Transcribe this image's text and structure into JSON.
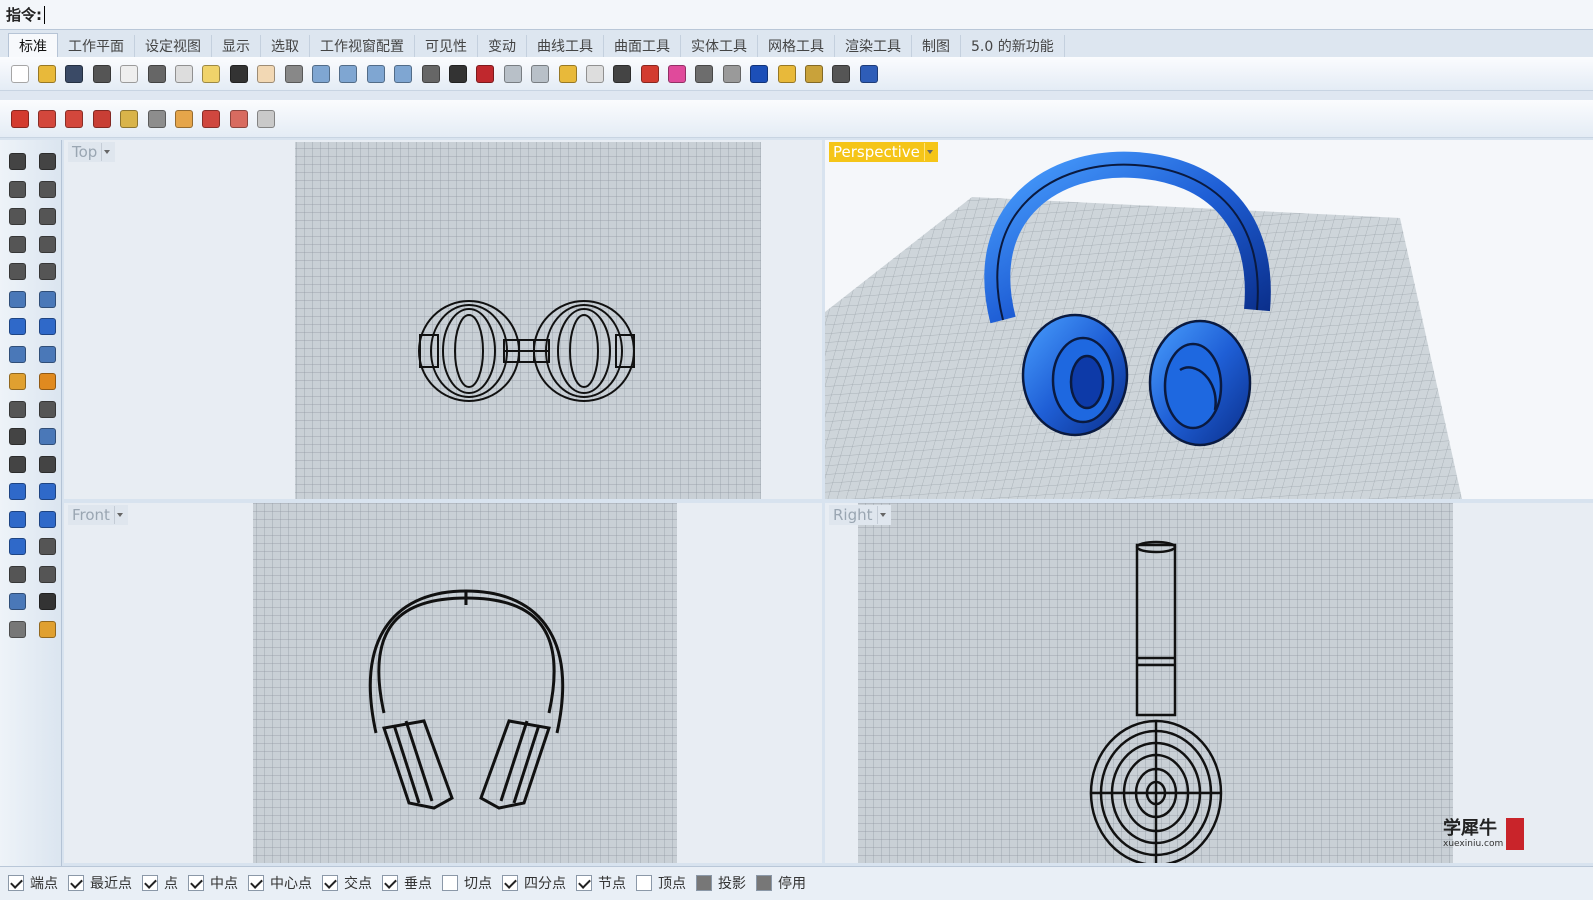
{
  "command": {
    "label": "指令:",
    "value": ""
  },
  "tabs": [
    {
      "label": "标准",
      "active": true
    },
    {
      "label": "工作平面"
    },
    {
      "label": "设定视图"
    },
    {
      "label": "显示"
    },
    {
      "label": "选取"
    },
    {
      "label": "工作视窗配置"
    },
    {
      "label": "可见性"
    },
    {
      "label": "变动"
    },
    {
      "label": "曲线工具"
    },
    {
      "label": "曲面工具"
    },
    {
      "label": "实体工具"
    },
    {
      "label": "网格工具"
    },
    {
      "label": "渲染工具"
    },
    {
      "label": "制图"
    },
    {
      "label": "5.0 的新功能"
    }
  ],
  "toolbar_main": [
    {
      "icon": "new-file-icon",
      "color": "#ffffff"
    },
    {
      "icon": "open-folder-icon",
      "color": "#e8b93a"
    },
    {
      "icon": "save-icon",
      "color": "#3a4a66"
    },
    {
      "icon": "print-icon",
      "color": "#555555"
    },
    {
      "icon": "page-setup-icon",
      "color": "#eeeeee"
    },
    {
      "icon": "cut-icon",
      "color": "#666666"
    },
    {
      "icon": "copy-icon",
      "color": "#dddddd"
    },
    {
      "icon": "paste-icon",
      "color": "#f0d36a"
    },
    {
      "icon": "undo-icon",
      "color": "#333333"
    },
    {
      "icon": "pan-hand-icon",
      "color": "#f2d8b4"
    },
    {
      "icon": "move-view-icon",
      "color": "#888888"
    },
    {
      "icon": "zoom-dynamic-icon",
      "color": "#7fa6d2"
    },
    {
      "icon": "zoom-window-icon",
      "color": "#7fa6d2"
    },
    {
      "icon": "zoom-extents-icon",
      "color": "#7fa6d2"
    },
    {
      "icon": "zoom-selected-icon",
      "color": "#7fa6d2"
    },
    {
      "icon": "rotate-view-icon",
      "color": "#666666"
    },
    {
      "icon": "viewport-layout-icon",
      "color": "#333333"
    },
    {
      "icon": "car-render-icon",
      "color": "#c0282d"
    },
    {
      "icon": "select-filter-icon",
      "color": "#b8c0c8"
    },
    {
      "icon": "object-snap-icon",
      "color": "#b8c0c8"
    },
    {
      "icon": "point-edit-icon",
      "color": "#e8b93a"
    },
    {
      "icon": "light-bulb-icon",
      "color": "#dddddd"
    },
    {
      "icon": "lock-icon",
      "color": "#444444"
    },
    {
      "icon": "layer-icon",
      "color": "#d33b2f"
    },
    {
      "icon": "color-wheel-icon",
      "color": "#e04a9b"
    },
    {
      "icon": "shaded-sphere-icon",
      "color": "#6d6d6d"
    },
    {
      "icon": "rendered-sphere-icon",
      "color": "#9a9a9a"
    },
    {
      "icon": "render-blue-sphere-icon",
      "color": "#1c4fb8"
    },
    {
      "icon": "dimension-icon",
      "color": "#e8b93a"
    },
    {
      "icon": "options-gear-icon",
      "color": "#c9a23a"
    },
    {
      "icon": "properties-icon",
      "color": "#555555"
    },
    {
      "icon": "help-icon",
      "color": "#2e5db8"
    }
  ],
  "toolbar_secondary": [
    {
      "icon": "layer-red-icon",
      "color": "#d33b2f"
    },
    {
      "icon": "layer-off-icon",
      "color": "#d3473c"
    },
    {
      "icon": "layer-on-icon",
      "color": "#d3473c"
    },
    {
      "icon": "layer-check-icon",
      "color": "#c83e35"
    },
    {
      "icon": "layer-lamp-icon",
      "color": "#d9b44a"
    },
    {
      "icon": "layer-lamp-off-icon",
      "color": "#8d8d8d"
    },
    {
      "icon": "layer-match-icon",
      "color": "#e5a54a"
    },
    {
      "icon": "layer-stack-icon",
      "color": "#cf473f"
    },
    {
      "icon": "layer-copy-icon",
      "color": "#d86b60"
    },
    {
      "icon": "layer-pages-icon",
      "color": "#c9c9c9"
    }
  ],
  "left_tools": [
    {
      "icon": "select-arrow-icon",
      "color": "#444444"
    },
    {
      "icon": "point-icon",
      "color": "#444444"
    },
    {
      "icon": "polyline-icon",
      "color": "#555555"
    },
    {
      "icon": "curve-cv-icon",
      "color": "#555555"
    },
    {
      "icon": "circle-icon",
      "color": "#555555"
    },
    {
      "icon": "ellipse-icon",
      "color": "#555555"
    },
    {
      "icon": "polygon-icon",
      "color": "#555555"
    },
    {
      "icon": "rectangle-icon",
      "color": "#555555"
    },
    {
      "icon": "hexagon-icon",
      "color": "#555555"
    },
    {
      "icon": "fillet-curve-icon",
      "color": "#555555"
    },
    {
      "icon": "surface-points-icon",
      "color": "#4a78b8"
    },
    {
      "icon": "surface-loft-icon",
      "color": "#4a78b8"
    },
    {
      "icon": "box-solid-icon",
      "color": "#2f69c9"
    },
    {
      "icon": "sphere-solid-icon",
      "color": "#2f69c9"
    },
    {
      "icon": "cylinder-icon",
      "color": "#4a78b8"
    },
    {
      "icon": "mesh-plane-icon",
      "color": "#4a78b8"
    },
    {
      "icon": "gear-orange-icon",
      "color": "#e0a030"
    },
    {
      "icon": "explode-icon",
      "color": "#e08a1f"
    },
    {
      "icon": "trim-icon",
      "color": "#555555"
    },
    {
      "icon": "split-icon",
      "color": "#555555"
    },
    {
      "icon": "boolean-union-icon",
      "color": "#444444"
    },
    {
      "icon": "boolean-split-icon",
      "color": "#4a78b8"
    },
    {
      "icon": "move-curve-icon",
      "color": "#444444"
    },
    {
      "icon": "rotate-curve-icon",
      "color": "#444444"
    },
    {
      "icon": "text-tool-icon",
      "color": "#2f69c9"
    },
    {
      "icon": "scale-icon",
      "color": "#2f69c9"
    },
    {
      "icon": "array-icon",
      "color": "#2f69c9"
    },
    {
      "icon": "dimension-tool-icon",
      "color": "#2f69c9"
    },
    {
      "icon": "box-edit-icon",
      "color": "#2f69c9"
    },
    {
      "icon": "grid-points-icon",
      "color": "#555555"
    },
    {
      "icon": "point-grid-icon",
      "color": "#555555"
    },
    {
      "icon": "align-icon",
      "color": "#555555"
    },
    {
      "icon": "analyze-icon",
      "color": "#4a78b8"
    },
    {
      "icon": "checkmark-icon",
      "color": "#333333"
    },
    {
      "icon": "render-tool-icon",
      "color": "#777777"
    },
    {
      "icon": "paint-bucket-icon",
      "color": "#e0a030"
    }
  ],
  "viewports": {
    "top": {
      "title": "Top"
    },
    "perspective": {
      "title": "Perspective",
      "active": true
    },
    "front": {
      "title": "Front"
    },
    "right": {
      "title": "Right"
    }
  },
  "status_snaps": [
    {
      "label": "端点",
      "state": "on"
    },
    {
      "label": "最近点",
      "state": "on"
    },
    {
      "label": "点",
      "state": "on"
    },
    {
      "label": "中点",
      "state": "on"
    },
    {
      "label": "中心点",
      "state": "on"
    },
    {
      "label": "交点",
      "state": "on"
    },
    {
      "label": "垂点",
      "state": "on"
    },
    {
      "label": "切点",
      "state": "off"
    },
    {
      "label": "四分点",
      "state": "on"
    },
    {
      "label": "节点",
      "state": "on"
    },
    {
      "label": "顶点",
      "state": "off"
    },
    {
      "label": "投影",
      "state": "filled"
    },
    {
      "label": "停用",
      "state": "filled"
    }
  ],
  "watermark": {
    "line1": "学犀牛",
    "line2": "xuexiniu.com"
  },
  "colors": {
    "accent_active_viewport": "#f5c518",
    "model_blue": "#1f5fd6",
    "grid_bg": "#c9d0d6"
  }
}
